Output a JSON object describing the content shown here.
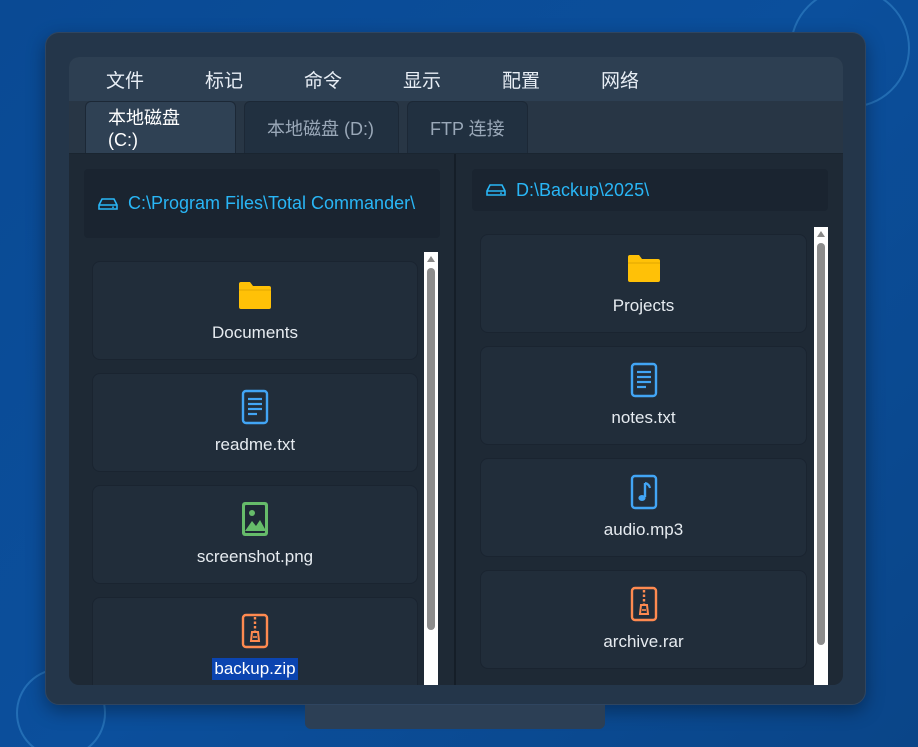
{
  "menu": [
    "文件",
    "标记",
    "命令",
    "显示",
    "配置",
    "网络"
  ],
  "tabs": [
    {
      "label": "本地磁盘 (C:)",
      "active": true
    },
    {
      "label": "本地磁盘 (D:)",
      "active": false
    },
    {
      "label": "FTP 连接",
      "active": false
    }
  ],
  "left_pane": {
    "path": "C:\\Program Files\\Total Commander\\",
    "files": [
      {
        "name": "Documents",
        "icon": "folder-icon",
        "selected": false
      },
      {
        "name": "readme.txt",
        "icon": "text-file-icon",
        "selected": false
      },
      {
        "name": "screenshot.png",
        "icon": "image-file-icon",
        "selected": false
      },
      {
        "name": "backup.zip",
        "icon": "archive-file-icon",
        "selected": true
      }
    ]
  },
  "right_pane": {
    "path": "D:\\Backup\\2025\\",
    "files": [
      {
        "name": "Projects",
        "icon": "folder-icon",
        "selected": false
      },
      {
        "name": "notes.txt",
        "icon": "text-file-icon",
        "selected": false
      },
      {
        "name": "audio.mp3",
        "icon": "audio-file-icon",
        "selected": false
      },
      {
        "name": "archive.rar",
        "icon": "archive-file-icon",
        "selected": false
      }
    ]
  },
  "colors": {
    "accent": "#29b6f6",
    "folder": "#ffc107",
    "text_file": "#42a5f5",
    "image_file": "#66bb6a",
    "archive_file": "#ff8a50",
    "selection": "#0b44b0"
  }
}
